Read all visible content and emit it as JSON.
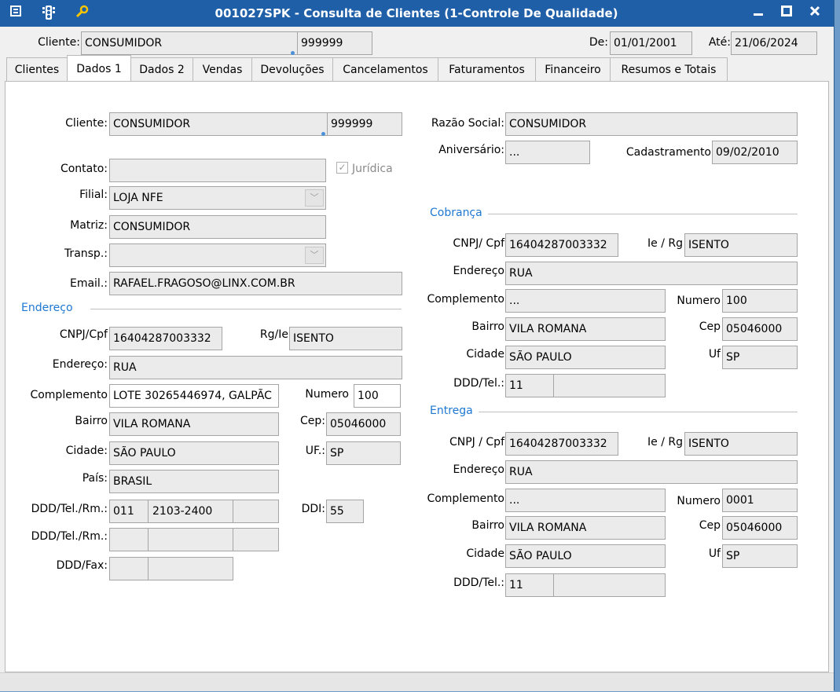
{
  "window": {
    "title": "001027SPK - Consulta de Clientes (1-Controle De Qualidade)"
  },
  "titlebar_icons": [
    "menu-icon",
    "traffic-light-icon",
    "tools-icon"
  ],
  "filter": {
    "cliente_label": "Cliente:",
    "cliente_name": "CONSUMIDOR",
    "cliente_code": "999999",
    "de_label": "De:",
    "de_value": "01/01/2001",
    "ate_label": "Até:",
    "ate_value": "21/06/2024"
  },
  "tabs": [
    "Clientes",
    "Dados 1",
    "Dados 2",
    "Vendas",
    "Devoluções",
    "Cancelamentos",
    "Faturamentos",
    "Financeiro",
    "Resumos e Totais"
  ],
  "active_tab": "Dados 1",
  "left": {
    "cliente_label": "Cliente:",
    "cliente_name": "CONSUMIDOR",
    "cliente_code": "999999",
    "contato_label": "Contato:",
    "contato_value": "",
    "juridica_label": "Jurídica",
    "juridica_checked": true,
    "filial_label": "Filial:",
    "filial_value": "LOJA NFE",
    "matriz_label": "Matriz:",
    "matriz_value": "CONSUMIDOR",
    "transp_label": "Transp.:",
    "transp_value": "",
    "email_label": "Email.:",
    "email_value": "RAFAEL.FRAGOSO@LINX.COM.BR"
  },
  "endereco": {
    "section": "Endereço",
    "cnpj_label": "CNPJ/Cpf",
    "cnpj_value": "16404287003332",
    "rg_label": "Rg/Ie",
    "rg_value": "ISENTO",
    "endereco_label": "Endereço:",
    "endereco_value": "RUA",
    "complemento_label": "Complemento",
    "complemento_value": "LOTE 30265446974, GALPÃC",
    "numero_label": "Numero",
    "numero_value": "100",
    "bairro_label": "Bairro",
    "bairro_value": "VILA ROMANA",
    "cep_label": "Cep:",
    "cep_value": "05046000",
    "cidade_label": "Cidade:",
    "cidade_value": "SÃO PAULO",
    "uf_label": "UF.:",
    "uf_value": "SP",
    "pais_label": "País:",
    "pais_value": "BRASIL",
    "tel1_label": "DDD/Tel./Rm.:",
    "tel1_ddd": "011",
    "tel1_num": "2103-2400",
    "tel1_rm": "",
    "ddi_label": "DDI:",
    "ddi_value": "55",
    "tel2_label": "DDD/Tel./Rm.:",
    "tel2_ddd": "",
    "tel2_num": "",
    "tel2_rm": "",
    "fax_label": "DDD/Fax:",
    "fax_ddd": "",
    "fax_num": ""
  },
  "right": {
    "razao_label": "Razão Social:",
    "razao_value": "CONSUMIDOR",
    "aniversario_label": "Aniversário:",
    "aniversario_value": "...",
    "cadastramento_label": "Cadastramento",
    "cadastramento_value": "09/02/2010"
  },
  "cobranca": {
    "section": "Cobrança",
    "cnpj_label": "CNPJ/ Cpf",
    "cnpj_value": "16404287003332",
    "ie_label": "Ie / Rg",
    "ie_value": "ISENTO",
    "endereco_label": "Endereço",
    "endereco_value": "RUA",
    "complemento_label": "Complemento",
    "complemento_value": "...",
    "numero_label": "Numero",
    "numero_value": "100",
    "bairro_label": "Bairro",
    "bairro_value": "VILA ROMANA",
    "cep_label": "Cep",
    "cep_value": "05046000",
    "cidade_label": "Cidade",
    "cidade_value": "SÃO PAULO",
    "uf_label": "Uf",
    "uf_value": "SP",
    "tel_label": "DDD/Tel.:",
    "tel_ddd": "11",
    "tel_num": ""
  },
  "entrega": {
    "section": "Entrega",
    "cnpj_label": "CNPJ / Cpf",
    "cnpj_value": "16404287003332",
    "ie_label": "Ie / Rg",
    "ie_value": "ISENTO",
    "endereco_label": "Endereço",
    "endereco_value": "RUA",
    "complemento_label": "Complemento",
    "complemento_value": "...",
    "numero_label": "Numero",
    "numero_value": "0001",
    "bairro_label": "Bairro",
    "bairro_value": "VILA ROMANA",
    "cep_label": "Cep",
    "cep_value": "05046000",
    "cidade_label": "Cidade",
    "cidade_value": "SÃO PAULO",
    "uf_label": "Uf",
    "uf_value": "SP",
    "tel_label": "DDD/Tel.:",
    "tel_ddd": "11",
    "tel_num": ""
  },
  "colors": {
    "titlebar": "#1f5fa8",
    "section": "#1e78d2",
    "field_bg": "#ebebeb"
  }
}
